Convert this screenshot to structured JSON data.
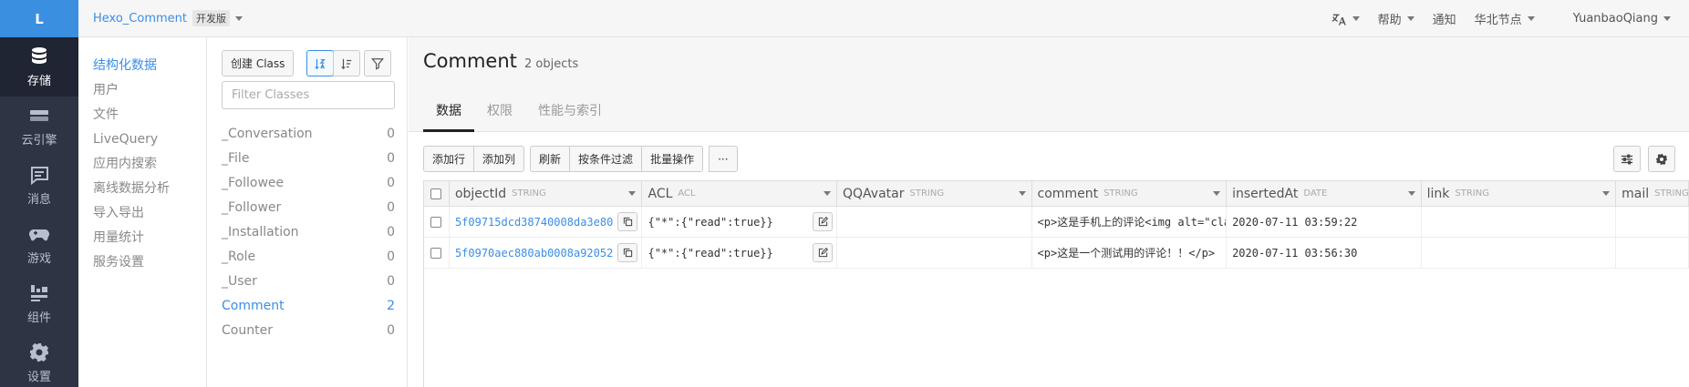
{
  "rail": {
    "logo": "L",
    "items": [
      {
        "label": "存储",
        "icon": "database-icon",
        "active": true
      },
      {
        "label": "云引擎",
        "icon": "cloud-engine-icon"
      },
      {
        "label": "消息",
        "icon": "message-icon"
      },
      {
        "label": "游戏",
        "icon": "gamepad-icon"
      },
      {
        "label": "组件",
        "icon": "components-icon"
      },
      {
        "label": "设置",
        "icon": "gear-icon"
      }
    ]
  },
  "topbar": {
    "app_name": "Hexo_Comment",
    "env_badge": "开发版",
    "help": "帮助",
    "notify": "通知",
    "region": "华北节点",
    "user": "YuanbaoQiang"
  },
  "subnav": {
    "items": [
      "结构化数据",
      "用户",
      "文件",
      "LiveQuery",
      "应用内搜索",
      "离线数据分析",
      "导入导出",
      "用量统计",
      "服务设置"
    ]
  },
  "classes": {
    "create_label": "创建 Class",
    "filter_placeholder": "Filter Classes",
    "list": [
      {
        "name": "_Conversation",
        "count": "0"
      },
      {
        "name": "_File",
        "count": "0"
      },
      {
        "name": "_Followee",
        "count": "0"
      },
      {
        "name": "_Follower",
        "count": "0"
      },
      {
        "name": "_Installation",
        "count": "0"
      },
      {
        "name": "_Role",
        "count": "0"
      },
      {
        "name": "_User",
        "count": "0"
      },
      {
        "name": "Comment",
        "count": "2"
      },
      {
        "name": "Counter",
        "count": "0"
      }
    ]
  },
  "main": {
    "title": "Comment",
    "count": "2 objects",
    "tabs": [
      "数据",
      "权限",
      "性能与索引"
    ],
    "toolbar": {
      "add_row": "添加行",
      "add_col": "添加列",
      "refresh": "刷新",
      "filter": "按条件过滤",
      "batch": "批量操作",
      "more": "···"
    },
    "columns": [
      {
        "name": "objectId",
        "type": "STRING"
      },
      {
        "name": "ACL",
        "type": "ACL"
      },
      {
        "name": "QQAvatar",
        "type": "STRING"
      },
      {
        "name": "comment",
        "type": "STRING"
      },
      {
        "name": "insertedAt",
        "type": "DATE"
      },
      {
        "name": "link",
        "type": "STRING"
      },
      {
        "name": "mail",
        "type": "STRING"
      }
    ],
    "rows": [
      {
        "objectId": "5f09715dcd38740008da3e80",
        "acl": "{\"*\":{\"read\":true}}",
        "qqavatar": "",
        "comment": "<p>这是手机上的评论<img alt=\"cla",
        "insertedAt": "2020-07-11 03:59:22",
        "link": "",
        "mail": ""
      },
      {
        "objectId": "5f0970aec880ab0008a92052",
        "acl": "{\"*\":{\"read\":true}}",
        "qqavatar": "",
        "comment": "<p>这是一个测试用的评论！！</p>",
        "insertedAt": "2020-07-11 03:56:30",
        "link": "",
        "mail": ""
      }
    ]
  }
}
